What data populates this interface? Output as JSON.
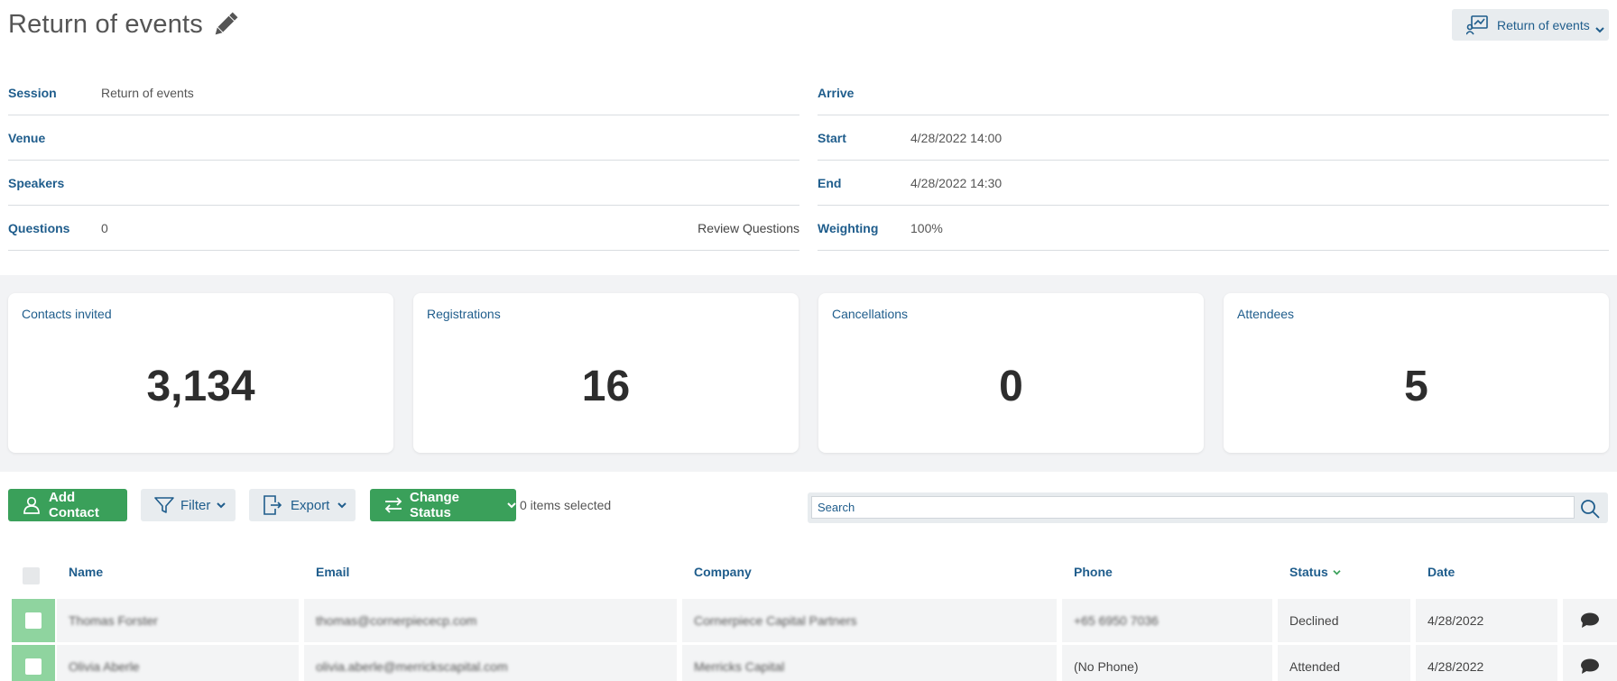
{
  "header": {
    "title": "Return of events",
    "session_selector": "Return of events"
  },
  "info_left": [
    {
      "label": "Session",
      "value": "Return of events"
    },
    {
      "label": "Venue",
      "value": ""
    },
    {
      "label": "Speakers",
      "value": ""
    },
    {
      "label": "Questions",
      "value": "0",
      "link": "Review Questions"
    }
  ],
  "info_right": [
    {
      "label": "Arrive",
      "value": ""
    },
    {
      "label": "Start",
      "value": "4/28/2022 14:00"
    },
    {
      "label": "End",
      "value": "4/28/2022 14:30"
    },
    {
      "label": "Weighting",
      "value": "100%"
    }
  ],
  "stats": [
    {
      "label": "Contacts invited",
      "value": "3,134"
    },
    {
      "label": "Registrations",
      "value": "16"
    },
    {
      "label": "Cancellations",
      "value": "0"
    },
    {
      "label": "Attendees",
      "value": "5"
    }
  ],
  "toolbar": {
    "add_contact": "Add Contact",
    "filter": "Filter",
    "export": "Export",
    "change_status": "Change Status",
    "items_selected": "0 items selected",
    "search_placeholder": "Search"
  },
  "table": {
    "columns": [
      "Name",
      "Email",
      "Company",
      "Phone",
      "Status",
      "Date"
    ],
    "sorted_column": "Status",
    "rows": [
      {
        "name": "Thomas Forster",
        "email": "thomas@cornerpiececp.com",
        "company": "Cornerpiece Capital Partners",
        "phone": "+65 6950 7036",
        "status": "Declined",
        "date": "4/28/2022"
      },
      {
        "name": "Olivia Aberle",
        "email": "olivia.aberle@merrickscapital.com",
        "company": "Merricks Capital",
        "phone": "(No Phone)",
        "status": "Attended",
        "date": "4/28/2022"
      }
    ]
  },
  "colors": {
    "accent_blue": "#1f5d8c",
    "green": "#3aa05a",
    "panel_grey": "#e8ecef"
  },
  "icons": [
    "pencil-icon",
    "session-chart-icon",
    "chevron-down-icon",
    "user-icon",
    "filter-icon",
    "export-icon",
    "swap-arrows-icon",
    "search-icon",
    "comment-icon"
  ]
}
